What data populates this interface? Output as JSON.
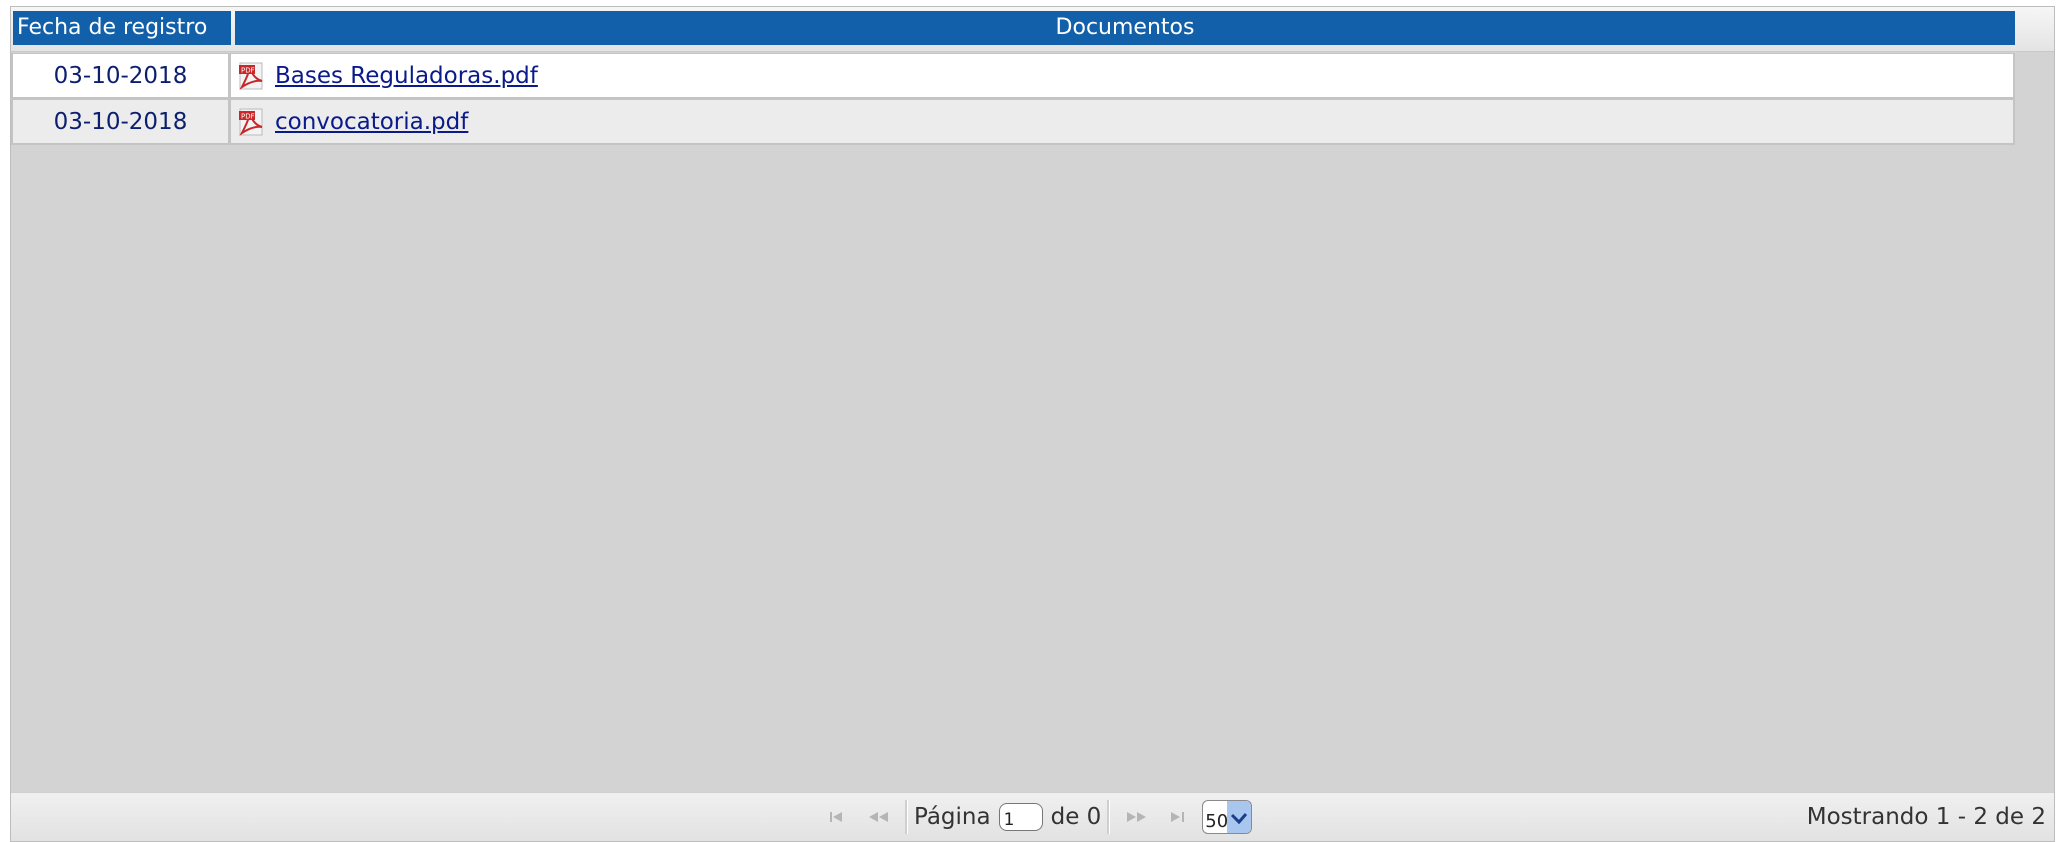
{
  "columns": {
    "date": "Fecha de registro",
    "docs": "Documentos"
  },
  "rows": [
    {
      "date": "03-10-2018",
      "document": "Bases Reguladoras.pdf",
      "icon": "pdf-icon"
    },
    {
      "date": "03-10-2018",
      "document": "convocatoria.pdf",
      "icon": "pdf-icon"
    }
  ],
  "pager": {
    "page_label": "Página",
    "page_value": "1",
    "of_label": "de 0",
    "page_size": "50",
    "showing": "Mostrando 1 - 2 de 2"
  },
  "colors": {
    "header_bg": "#1260aa",
    "link": "#0a1a8a",
    "grid_bg": "#d3d3d3"
  }
}
